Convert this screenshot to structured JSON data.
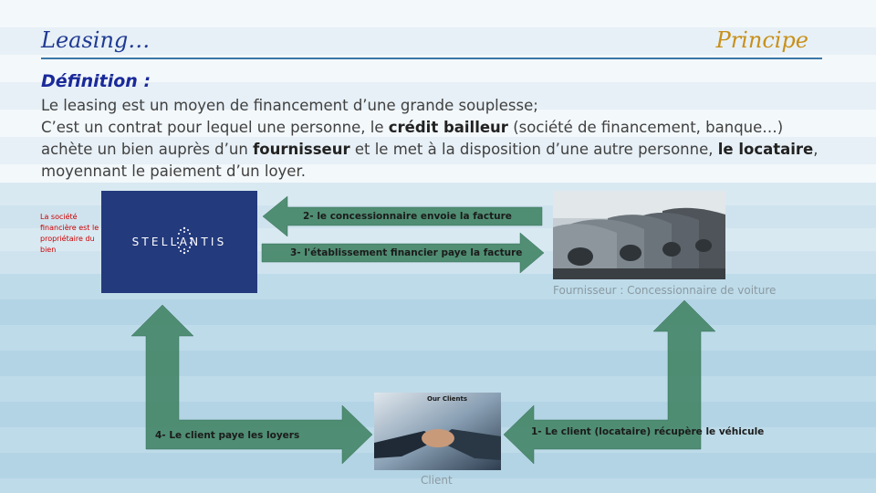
{
  "header": {
    "title_left": "Leasing…",
    "title_right": "Principe"
  },
  "definition": {
    "heading": "Définition :",
    "line1": "Le leasing est un moyen de financement d’une grande souplesse;",
    "line2_a": "C’est un contrat pour lequel une personne,  le ",
    "line2_b": "crédit bailleur",
    "line2_c": " (société de financement, banque…) achète un bien auprès d’un ",
    "line2_d": "fournisseur",
    "line2_e": " et le met à la disposition d’une autre personne, ",
    "line2_f": "le locataire",
    "line2_g": ", moyennant le paiement d’un loyer."
  },
  "diagram": {
    "owner_note": "La société financière est le propriétaire du bien",
    "logo_text": "STELLANTIS",
    "arrow_2": "2- le concessionnaire envoie la facture",
    "arrow_3": "3- l'établissement financier paye la facture",
    "arrow_4": "4- Le client paye les loyers",
    "arrow_1": "1- Le client (locataire) récupère le véhicule",
    "supplier_caption": "Fournisseur : Concessionnaire de voiture",
    "client_caption": "Client",
    "handshake_text": "Our Clients",
    "arrow_color": "#4a8a6e",
    "logo_bg": "#233a7d"
  }
}
